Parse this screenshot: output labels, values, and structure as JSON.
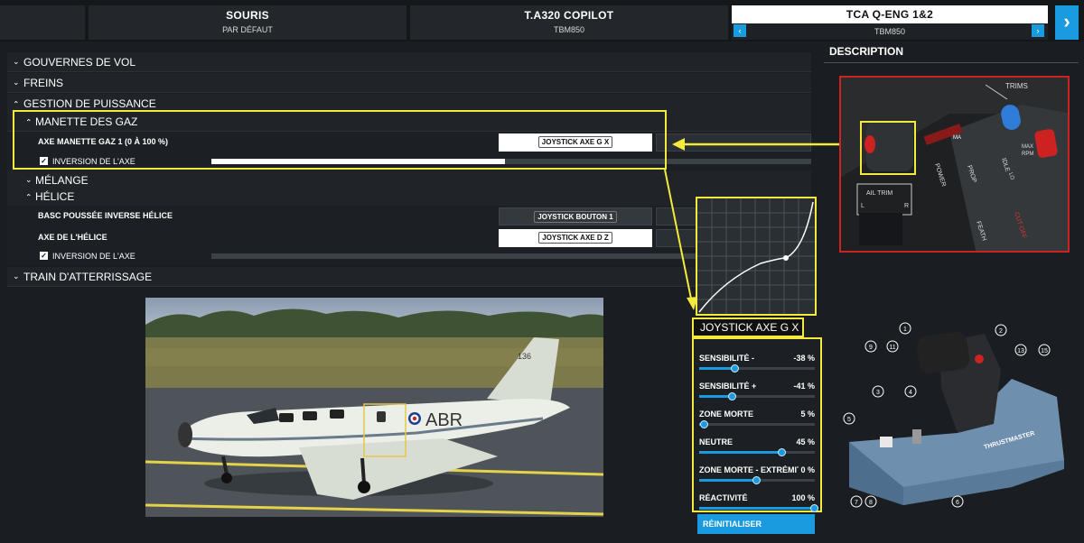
{
  "tabs": [
    {
      "title": "SOURIS",
      "subtitle": "PAR DÉFAUT"
    },
    {
      "title": "T.A320 COPILOT",
      "subtitle": "TBM850"
    },
    {
      "title": "TCA Q-ENG 1&2",
      "subtitle": "TBM850"
    }
  ],
  "icons": {
    "next": "›",
    "prev_small": "‹",
    "next_small": "›",
    "check": "✓",
    "chevron": "⌄"
  },
  "categories": {
    "gouvernes": "GOUVERNES DE VOL",
    "freins": "FREINS",
    "puissance": "GESTION DE PUISSANCE",
    "manette": "MANETTE DES GAZ",
    "melange": "MÉLANGE",
    "helice": "HÉLICE",
    "train": "TRAIN D'ATTERRISSAGE"
  },
  "bindings": {
    "axe_gaz": {
      "label": "AXE MANETTE GAZ 1 (0 À 100 %)",
      "key": "JOYSTICK AXE G X"
    },
    "inv_gaz": {
      "label": "INVERSION DE L'AXE",
      "value": 0.49
    },
    "basc": {
      "label": "BASC POUSSÉE INVERSE HÉLICE",
      "key": "JOYSTICK BOUTON 1"
    },
    "axe_helice": {
      "label": "AXE DE L'HÉLICE",
      "key": "JOYSTICK AXE D Z"
    },
    "inv_helice": {
      "label": "INVERSION DE L'AXE"
    }
  },
  "curve": {
    "axis_label": "JOYSTICK AXE G X"
  },
  "sliders": [
    {
      "name": "SENSIBILITÉ -",
      "value": "-38 %",
      "pos": 0.31
    },
    {
      "name": "SENSIBILITÉ +",
      "value": "-41 %",
      "pos": 0.29
    },
    {
      "name": "ZONE MORTE",
      "value": "5 %",
      "pos": 0.05
    },
    {
      "name": "NEUTRE",
      "value": "45 %",
      "pos": 0.72
    },
    {
      "name": "ZONE MORTE - EXTRÉMITÉ",
      "value": "0 %",
      "pos": 0.5
    },
    {
      "name": "RÉACTIVITÉ",
      "value": "100 %",
      "pos": 1.0
    }
  ],
  "reset_label": "RÉINITIALISER",
  "description": {
    "title": "DESCRIPTION"
  },
  "cockpit_labels": {
    "trims": "TRIMS",
    "power": "POWER",
    "prop": "PROP",
    "max": "MAX",
    "rpm": "RPM",
    "feath": "FEATH",
    "cutoff": "CUT OFF",
    "ail_trim": "AIL TRIM",
    "l": "L",
    "r": "R",
    "idle": "IDLE",
    "lo": "LO",
    "ma": "MA"
  },
  "plane": {
    "registration": "ABR",
    "tail": "136"
  },
  "hardware": {
    "brand": "THRUSTMASTER",
    "callouts": [
      "1",
      "2",
      "3",
      "4",
      "5",
      "6",
      "7",
      "8",
      "9",
      "11",
      "13",
      "15"
    ]
  }
}
